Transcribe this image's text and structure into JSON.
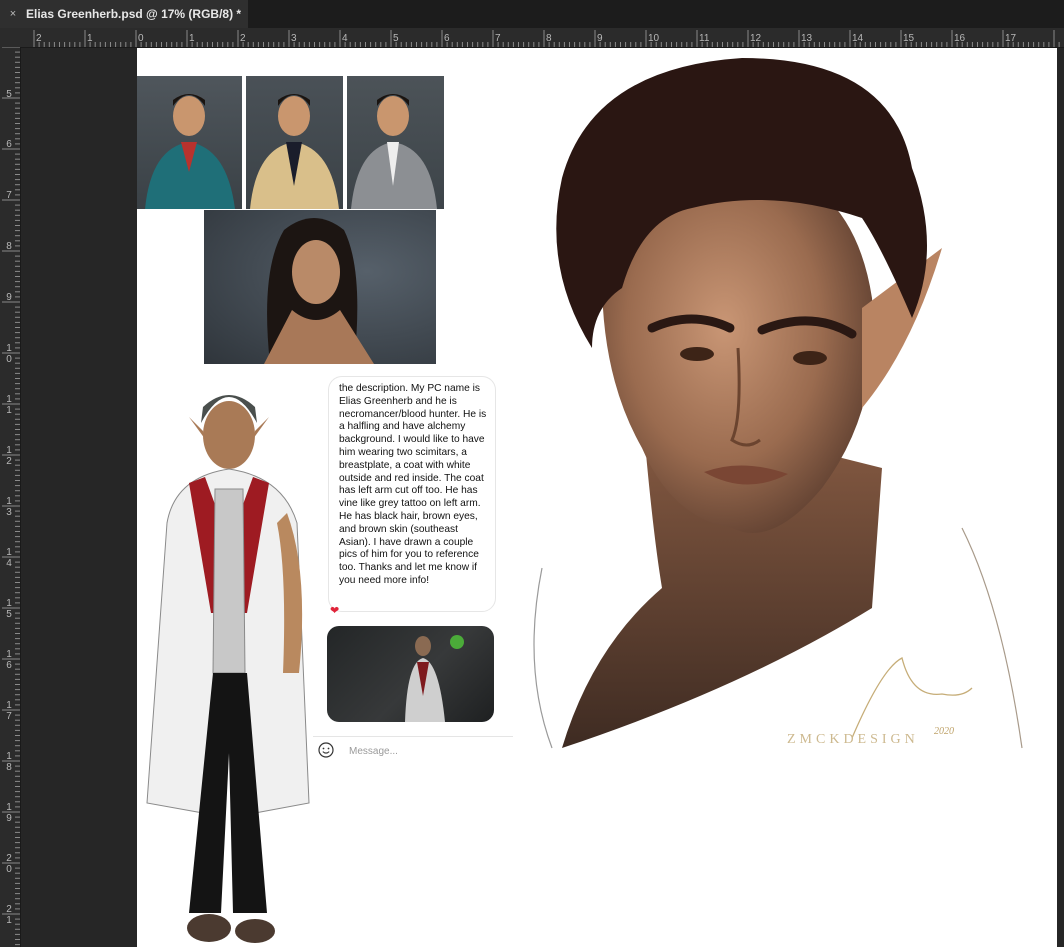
{
  "tab": {
    "close_glyph": "×",
    "title": "Elias Greenherb.psd @ 17% (RGB/8) *"
  },
  "ruler": {
    "top_labels": [
      "2",
      "1",
      "0",
      "1",
      "2",
      "3",
      "4",
      "5",
      "6",
      "7",
      "8",
      "9",
      "10",
      "11",
      "12",
      "13",
      "14",
      "15",
      "16",
      "17"
    ],
    "left_labels": [
      "5",
      "6",
      "7",
      "8",
      "9",
      "1\n0",
      "1\n1",
      "1\n2",
      "1\n3",
      "1\n4",
      "1\n5",
      "1\n6",
      "1\n7",
      "1\n8",
      "1\n9",
      "2\n0",
      "2\n1"
    ]
  },
  "chat": {
    "message": "the description. My PC name is Elias Greenherb and he is necromancer/blood hunter. He is a halfling and have alchemy background. I would like to have him wearing two scimitars, a breastplate, a coat with white outside and red inside. The coat has left arm cut off too. He has vine like grey tattoo on left arm. He has black hair, brown eyes, and brown skin (southeast Asian). I have drawn a couple pics of him for you to reference too. Thanks and let me know if you need more info!",
    "reaction": "❤",
    "input_placeholder": "Message..."
  },
  "artwork": {
    "watermark": "ZMCKDESIGN",
    "year": "2020"
  },
  "icons": {
    "tab_close": "close-icon",
    "composer": "smiley-icon"
  }
}
